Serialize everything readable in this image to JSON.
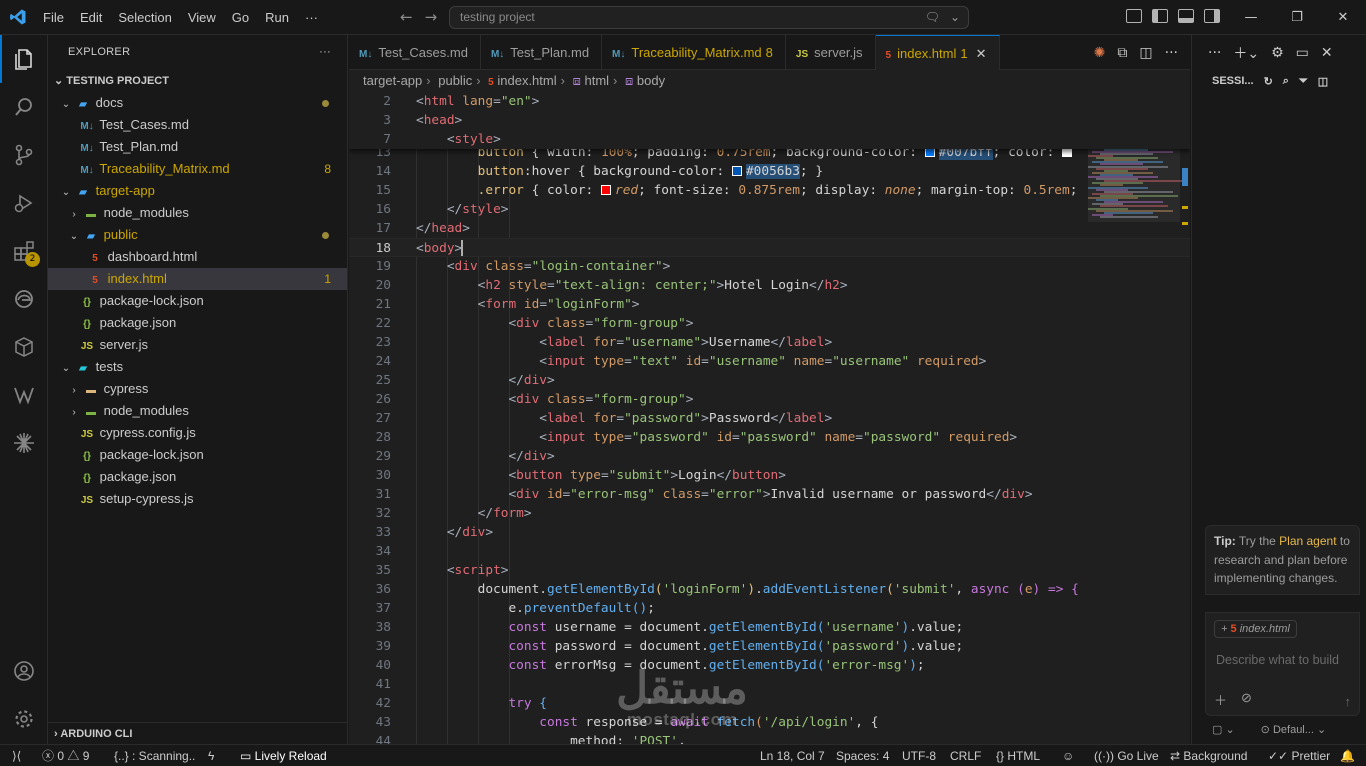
{
  "menu": [
    "File",
    "Edit",
    "Selection",
    "View",
    "Go",
    "Run",
    "···"
  ],
  "search_placeholder": "testing project",
  "explorer": {
    "title": "EXPLORER",
    "more": "···",
    "project": "TESTING PROJECT",
    "tree": [
      {
        "label": "docs",
        "type": "folder",
        "indent": 1,
        "open": true,
        "color": "folder-b",
        "dot": true
      },
      {
        "label": "Test_Cases.md",
        "type": "md",
        "indent": 2
      },
      {
        "label": "Test_Plan.md",
        "type": "md",
        "indent": 2
      },
      {
        "label": "Traceability_Matrix.md",
        "type": "md",
        "indent": 2,
        "count": "8",
        "warn": true
      },
      {
        "label": "target-app",
        "type": "folder",
        "indent": 1,
        "open": true,
        "color": "folder-b",
        "warn": true
      },
      {
        "label": "node_modules",
        "type": "folder",
        "indent": 2,
        "open": false,
        "color": "folder-g"
      },
      {
        "label": "public",
        "type": "folder",
        "indent": 2,
        "open": true,
        "color": "folder-b",
        "dot": true,
        "warn": true
      },
      {
        "label": "dashboard.html",
        "type": "html",
        "indent": 3
      },
      {
        "label": "index.html",
        "type": "html",
        "indent": 3,
        "count": "1",
        "warn": true,
        "selected": true
      },
      {
        "label": "package-lock.json",
        "type": "json",
        "indent": 2
      },
      {
        "label": "package.json",
        "type": "json",
        "indent": 2
      },
      {
        "label": "server.js",
        "type": "js",
        "indent": 2
      },
      {
        "label": "tests",
        "type": "folder",
        "indent": 1,
        "open": true,
        "color": "folder-t"
      },
      {
        "label": "cypress",
        "type": "folder",
        "indent": 2,
        "open": false,
        "color": "folder"
      },
      {
        "label": "node_modules",
        "type": "folder",
        "indent": 2,
        "open": false,
        "color": "folder-g"
      },
      {
        "label": "cypress.config.js",
        "type": "js",
        "indent": 2
      },
      {
        "label": "package-lock.json",
        "type": "json",
        "indent": 2
      },
      {
        "label": "package.json",
        "type": "json",
        "indent": 2
      },
      {
        "label": "setup-cypress.js",
        "type": "js",
        "indent": 2
      }
    ],
    "bottom_section": "ARDUINO CLI"
  },
  "tabs": [
    {
      "label": "Test_Cases.md",
      "type": "md"
    },
    {
      "label": "Test_Plan.md",
      "type": "md"
    },
    {
      "label": "Traceability_Matrix.md",
      "type": "md",
      "count": "8",
      "warn": true
    },
    {
      "label": "server.js",
      "type": "js"
    },
    {
      "label": "index.html",
      "type": "html",
      "count": "1",
      "warn": true,
      "active": true
    }
  ],
  "breadcrumb": [
    "target-app",
    "public",
    "index.html",
    "html",
    "body"
  ],
  "code": {
    "sticky": [
      {
        "n": "2",
        "html": "<span class='p'>&lt;</span><span class='tg'>html</span> <span class='a'>lang</span><span class='p'>=</span><span class='s'>\"en\"</span><span class='p'>&gt;</span>"
      },
      {
        "n": "3",
        "html": "<span class='p'>&lt;</span><span class='tg'>head</span><span class='p'>&gt;</span>"
      },
      {
        "n": "7",
        "html": "    <span class='p'>&lt;</span><span class='tg'>style</span><span class='p'>&gt;</span>"
      }
    ],
    "lines": [
      {
        "n": "13",
        "html": "        <span class='v'>button</span> <span class='w'>{</span> <span class='w'>width:</span> <span class='a'>100%</span><span class='w'>;</span> <span class='w'>padding:</span> <span class='a'>0.75rem</span><span class='w'>;</span> <span class='w'>background-color:</span> <span class='sw' style='background:#007bff'></span><span class='hl w'>#007bff</span><span class='w'>;</span> <span class='w'>color:</span> <span class='sw' style='background:#ffffff'></span>"
      },
      {
        "n": "14",
        "html": "        <span class='v'>button</span><span class='w'>:hover</span> <span class='w'>{</span> <span class='w'>background-color:</span> <span class='sw' style='background:#0056b3'></span><span class='hl w'>#0056b3</span><span class='w'>;</span> <span class='w'>}</span>"
      },
      {
        "n": "15",
        "html": "        <span class='v'>.error</span> <span class='w'>{</span> <span class='w'>color:</span> <span class='sw' style='background:#ff0000'></span><span class='a it'>red</span><span class='w'>;</span> <span class='w'>font-size:</span> <span class='a'>0.875rem</span><span class='w'>;</span> <span class='w'>display:</span> <span class='a it'>none</span><span class='w'>;</span> <span class='w'>margin-top:</span> <span class='a'>0.5rem</span><span class='w'>;</span>"
      },
      {
        "n": "16",
        "html": "    <span class='p'>&lt;/</span><span class='tg'>style</span><span class='p'>&gt;</span>"
      },
      {
        "n": "17",
        "html": "<span class='p'>&lt;/</span><span class='tg'>head</span><span class='p'>&gt;</span>"
      },
      {
        "n": "18",
        "html": "<span class='p'>&lt;</span><span class='tg'>body</span><span class='p'>&gt;</span>",
        "current": true
      },
      {
        "n": "19",
        "html": "    <span class='p'>&lt;</span><span class='tg'>div</span> <span class='a'>class</span><span class='p'>=</span><span class='s'>\"login-container\"</span><span class='p'>&gt;</span>"
      },
      {
        "n": "20",
        "html": "        <span class='p'>&lt;</span><span class='tg'>h2</span> <span class='a'>style</span><span class='p'>=</span><span class='s'>\"text-align: center;\"</span><span class='p'>&gt;</span><span class='w'>Hotel Login</span><span class='p'>&lt;/</span><span class='tg'>h2</span><span class='p'>&gt;</span>"
      },
      {
        "n": "21",
        "html": "        <span class='p'>&lt;</span><span class='tg'>form</span> <span class='a'>id</span><span class='p'>=</span><span class='s'>\"loginForm\"</span><span class='p'>&gt;</span>"
      },
      {
        "n": "22",
        "html": "            <span class='p'>&lt;</span><span class='tg'>div</span> <span class='a'>class</span><span class='p'>=</span><span class='s'>\"form-group\"</span><span class='p'>&gt;</span>"
      },
      {
        "n": "23",
        "html": "                <span class='p'>&lt;</span><span class='tg'>label</span> <span class='a'>for</span><span class='p'>=</span><span class='s'>\"username\"</span><span class='p'>&gt;</span><span class='w'>Username</span><span class='p'>&lt;/</span><span class='tg'>label</span><span class='p'>&gt;</span>"
      },
      {
        "n": "24",
        "html": "                <span class='p'>&lt;</span><span class='tg'>input</span> <span class='a'>type</span><span class='p'>=</span><span class='s'>\"text\"</span> <span class='a'>id</span><span class='p'>=</span><span class='s'>\"username\"</span> <span class='a'>name</span><span class='p'>=</span><span class='s'>\"username\"</span> <span class='a'>required</span><span class='p'>&gt;</span>"
      },
      {
        "n": "25",
        "html": "            <span class='p'>&lt;/</span><span class='tg'>div</span><span class='p'>&gt;</span>"
      },
      {
        "n": "26",
        "html": "            <span class='p'>&lt;</span><span class='tg'>div</span> <span class='a'>class</span><span class='p'>=</span><span class='s'>\"form-group\"</span><span class='p'>&gt;</span>"
      },
      {
        "n": "27",
        "html": "                <span class='p'>&lt;</span><span class='tg'>label</span> <span class='a'>for</span><span class='p'>=</span><span class='s'>\"password\"</span><span class='p'>&gt;</span><span class='w'>Password</span><span class='p'>&lt;/</span><span class='tg'>label</span><span class='p'>&gt;</span>"
      },
      {
        "n": "28",
        "html": "                <span class='p'>&lt;</span><span class='tg'>input</span> <span class='a'>type</span><span class='p'>=</span><span class='s'>\"password\"</span> <span class='a'>id</span><span class='p'>=</span><span class='s'>\"password\"</span> <span class='a'>name</span><span class='p'>=</span><span class='s'>\"password\"</span> <span class='a'>required</span><span class='p'>&gt;</span>"
      },
      {
        "n": "29",
        "html": "            <span class='p'>&lt;/</span><span class='tg'>div</span><span class='p'>&gt;</span>"
      },
      {
        "n": "30",
        "html": "            <span class='p'>&lt;</span><span class='tg'>button</span> <span class='a'>type</span><span class='p'>=</span><span class='s'>\"submit\"</span><span class='p'>&gt;</span><span class='w'>Login</span><span class='p'>&lt;/</span><span class='tg'>button</span><span class='p'>&gt;</span>"
      },
      {
        "n": "31",
        "html": "            <span class='p'>&lt;</span><span class='tg'>div</span> <span class='a'>id</span><span class='p'>=</span><span class='s'>\"error-msg\"</span> <span class='a'>class</span><span class='p'>=</span><span class='s'>\"error\"</span><span class='p'>&gt;</span><span class='w'>Invalid username or password</span><span class='p'>&lt;/</span><span class='tg'>div</span><span class='p'>&gt;</span>"
      },
      {
        "n": "32",
        "html": "        <span class='p'>&lt;/</span><span class='tg'>form</span><span class='p'>&gt;</span>"
      },
      {
        "n": "33",
        "html": "    <span class='p'>&lt;/</span><span class='tg'>div</span><span class='p'>&gt;</span>"
      },
      {
        "n": "34",
        "html": ""
      },
      {
        "n": "35",
        "html": "    <span class='p'>&lt;</span><span class='tg'>script</span><span class='p'>&gt;</span>"
      },
      {
        "n": "36",
        "html": "        <span class='w'>document</span><span class='w'>.</span><span class='f'>getElementById</span><span class='v'>(</span><span class='s'>'loginForm'</span><span class='v'>)</span><span class='w'>.</span><span class='f'>addEventListener</span><span class='v'>(</span><span class='s'>'submit'</span><span class='w'>,</span> <span class='k'>async</span> <span class='k'>(</span><span class='a'>e</span><span class='k'>)</span> <span class='k'>=&gt;</span> <span class='k'>{</span>"
      },
      {
        "n": "37",
        "html": "            <span class='w'>e</span><span class='w'>.</span><span class='f'>preventDefault</span><span class='f'>()</span><span class='w'>;</span>"
      },
      {
        "n": "38",
        "html": "            <span class='k'>const</span> <span class='w'>username</span> <span class='w'>=</span> <span class='w'>document</span><span class='w'>.</span><span class='f'>getElementById</span><span class='f'>(</span><span class='s'>'username'</span><span class='f'>)</span><span class='w'>.value;</span>"
      },
      {
        "n": "39",
        "html": "            <span class='k'>const</span> <span class='w'>password</span> <span class='w'>=</span> <span class='w'>document</span><span class='w'>.</span><span class='f'>getElementById</span><span class='f'>(</span><span class='s'>'password'</span><span class='f'>)</span><span class='w'>.value;</span>"
      },
      {
        "n": "40",
        "html": "            <span class='k'>const</span> <span class='w'>errorMsg</span> <span class='w'>=</span> <span class='w'>document</span><span class='w'>.</span><span class='f'>getElementById</span><span class='f'>(</span><span class='s'>'error-msg'</span><span class='f'>)</span><span class='w'>;</span>"
      },
      {
        "n": "41",
        "html": ""
      },
      {
        "n": "42",
        "html": "            <span class='k'>try</span> <span class='f'>{</span>"
      },
      {
        "n": "43",
        "html": "                <span class='k'>const</span> <span class='w'>response</span> <span class='w'>=</span> <span class='k'>await</span> <span class='f'>fetch</span><span class='a'>(</span><span class='s'>'/api/login'</span><span class='w'>,</span> <span class='w'>{</span>"
      },
      {
        "n": "44",
        "html": "                    <span class='w'>method: </span><span class='s'>'POST'</span><span class='w'>,</span>"
      }
    ]
  },
  "chat": {
    "section": "SESSI...",
    "tip_label": "Tip:",
    "tip_pre": "Try the",
    "tip_link": "Plan agent",
    "tip_post": "to research and plan before implementing changes.",
    "chip": "index.html",
    "placeholder": "Describe what to build",
    "footer_left": "▢ ⌄",
    "footer_right": "Defaul..."
  },
  "status": {
    "errors": "0",
    "warnings": "9",
    "scanning": "{..} : Scanning..",
    "lively": "Lively Reload",
    "position": "Ln 18, Col 7",
    "spaces": "Spaces: 4",
    "encoding": "UTF-8",
    "eol": "CRLF",
    "language": "HTML",
    "golive": "Go Live",
    "background": "Background",
    "prettier": "Prettier"
  },
  "watermark": {
    "arabic": "مستقل",
    "latin": "mostaql.com"
  }
}
